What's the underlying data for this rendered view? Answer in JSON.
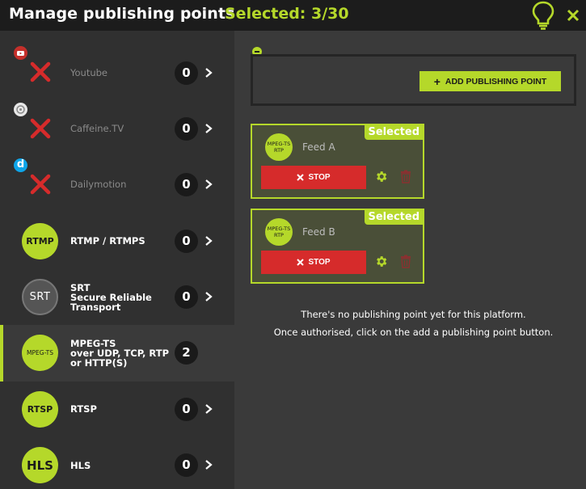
{
  "header": {
    "title": "Manage publishing points",
    "selected": "Selected: 3/30"
  },
  "sidebar": {
    "items": [
      {
        "label": "Youtube",
        "count": "0",
        "icon": "youtube-icon",
        "status": "not-authorised"
      },
      {
        "label": "Caffeine.TV",
        "count": "0",
        "icon": "caffeine-icon",
        "status": "not-authorised"
      },
      {
        "label": "Dailymotion",
        "count": "0",
        "icon": "dailymotion-icon",
        "status": "not-authorised"
      },
      {
        "label": "RTMP / RTMPS",
        "count": "0",
        "logo": "RTMP"
      },
      {
        "label_lines": [
          "SRT",
          "Secure Reliable",
          "Transport"
        ],
        "count": "0",
        "logo": "SRT"
      },
      {
        "label_lines": [
          "MPEG-TS",
          "over UDP, TCP, RTP",
          "or HTTP(S)"
        ],
        "count": "2",
        "logo": "MPEG-TS",
        "active": true
      },
      {
        "label": "RTSP",
        "count": "0",
        "logo": "RTSP"
      },
      {
        "label": "HLS",
        "count": "0",
        "logo": "HLS"
      }
    ]
  },
  "main": {
    "add_button": "ADD PUBLISHING POINT",
    "feeds": [
      {
        "name": "Feed A",
        "badge": "Selected",
        "logo_lines": [
          "MPEG-TS",
          "RTP"
        ],
        "stop_label": "STOP"
      },
      {
        "name": "Feed B",
        "badge": "Selected",
        "logo_lines": [
          "MPEG-TS",
          "RTP"
        ],
        "stop_label": "STOP"
      }
    ],
    "empty_line1": "There's no publishing point yet for this platform.",
    "empty_line2": "Once authorised, click on the add a publishing point button."
  },
  "colors": {
    "accent": "#b5d82a",
    "danger": "#d62b2b",
    "header_bg": "#1c1c1c",
    "sidebar_bg": "#303030",
    "main_bg": "#3a3a3a"
  }
}
